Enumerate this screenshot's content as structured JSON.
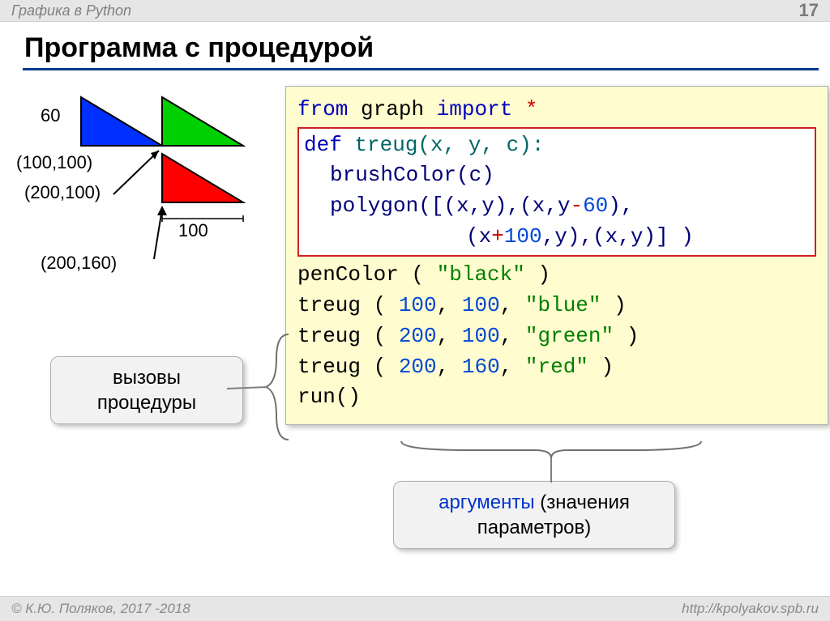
{
  "header": {
    "topic": "Графика в Python",
    "page_number": "17",
    "title": "Программа с процедурой"
  },
  "diagram": {
    "size_label": "60",
    "width_label": "100",
    "pt1": "(100,100)",
    "pt2": "(200,100)",
    "pt3": "(200,160)"
  },
  "code": {
    "l1_from": "from",
    "l1_mod": "graph",
    "l1_import": "import",
    "l1_star": "*",
    "def_kw": "def",
    "def_name": "treug(x, y, c):",
    "def_b1": "brushColor(c)",
    "def_b2a": "polygon([(x,y),(x,y",
    "def_b2_minus": "-",
    "def_b2_num": "60",
    "def_b2b": "),",
    "def_b3a": "(x",
    "def_b3_plus": "+",
    "def_b3_num": "100",
    "def_b3b": ",y),(x,y)] )",
    "pen": "penColor ( ",
    "pen_arg": "\"black\"",
    "pen_close": " )",
    "call1_fn": "treug ( ",
    "call1_a": "100",
    "call1_b": "100",
    "call1_c": "\"blue\"",
    "call2_a": "200",
    "call2_b": "100",
    "call2_c": "\"green\"",
    "call3_a": "200",
    "call3_b": "160",
    "call3_c": "\"red\"",
    "call_close": " )",
    "run": "run()"
  },
  "callouts": {
    "left_line1": "вызовы",
    "left_line2": "процедуры",
    "bottom_word1": "аргументы",
    "bottom_rest": " (значения параметров)"
  },
  "footer": {
    "copyright": "© К.Ю. Поляков, 2017 -2018",
    "url": "http://kpolyakov.spb.ru"
  }
}
